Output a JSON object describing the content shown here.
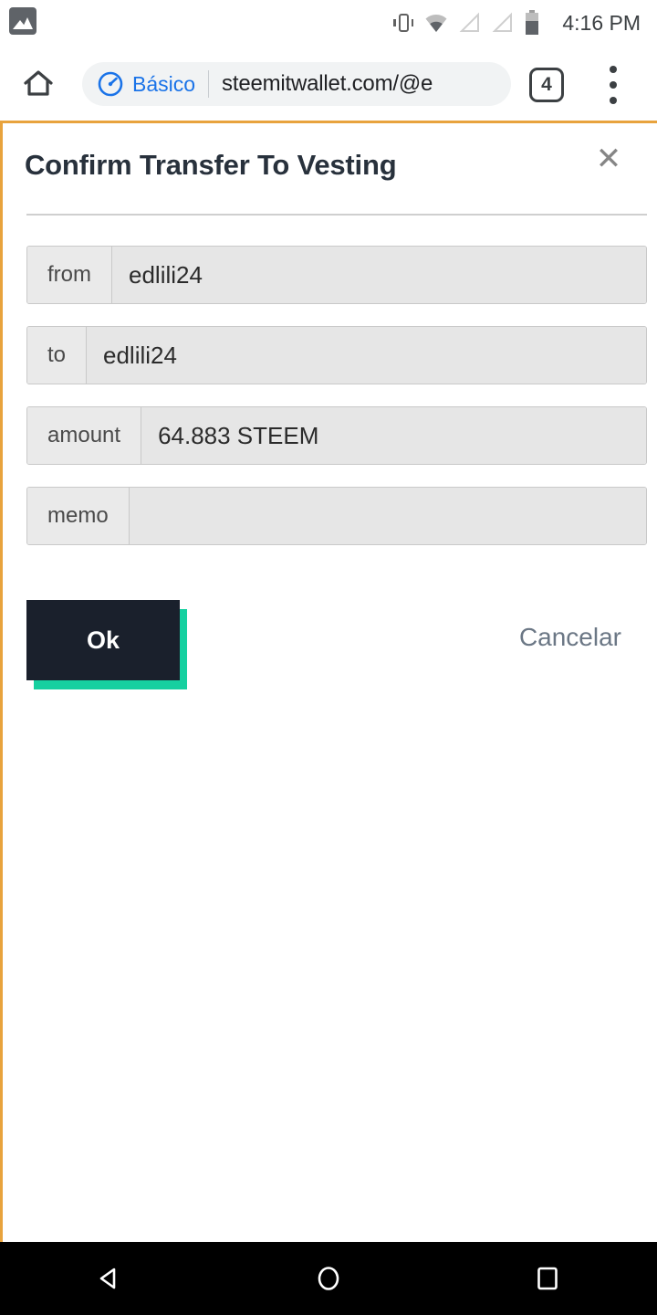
{
  "status_bar": {
    "notification_icon": "image-notification-icon",
    "icons": [
      "vibrate-icon",
      "wifi-icon",
      "signal-icon-1",
      "signal-icon-2",
      "battery-icon"
    ],
    "time": "4:16 PM"
  },
  "browser": {
    "home_icon": "home-icon",
    "lite_mode_label": "Básico",
    "lite_mode_icon": "speedometer-icon",
    "url": "steemitwallet.com/@e",
    "tab_count": "4",
    "menu_icon": "overflow-menu-icon",
    "accent_color": "#1a73e8"
  },
  "dialog": {
    "title": "Confirm Transfer To Vesting",
    "close_icon": "close-icon",
    "close_label": "✕",
    "fields": [
      {
        "label": "from",
        "value": "edlili24"
      },
      {
        "label": "to",
        "value": "edlili24"
      },
      {
        "label": "amount",
        "value": "64.883 STEEM"
      },
      {
        "label": "memo",
        "value": ""
      }
    ],
    "ok_label": "Ok",
    "cancel_label": "Cancelar",
    "ok_bg_color": "#1a202c",
    "ok_shadow_color": "#16d0a0",
    "cancel_color": "#6b7785",
    "page_border_color": "#e8a33d"
  },
  "nav_bar": {
    "back_icon": "back-triangle-icon",
    "home_icon": "home-circle-icon",
    "recents_icon": "recents-square-icon"
  }
}
